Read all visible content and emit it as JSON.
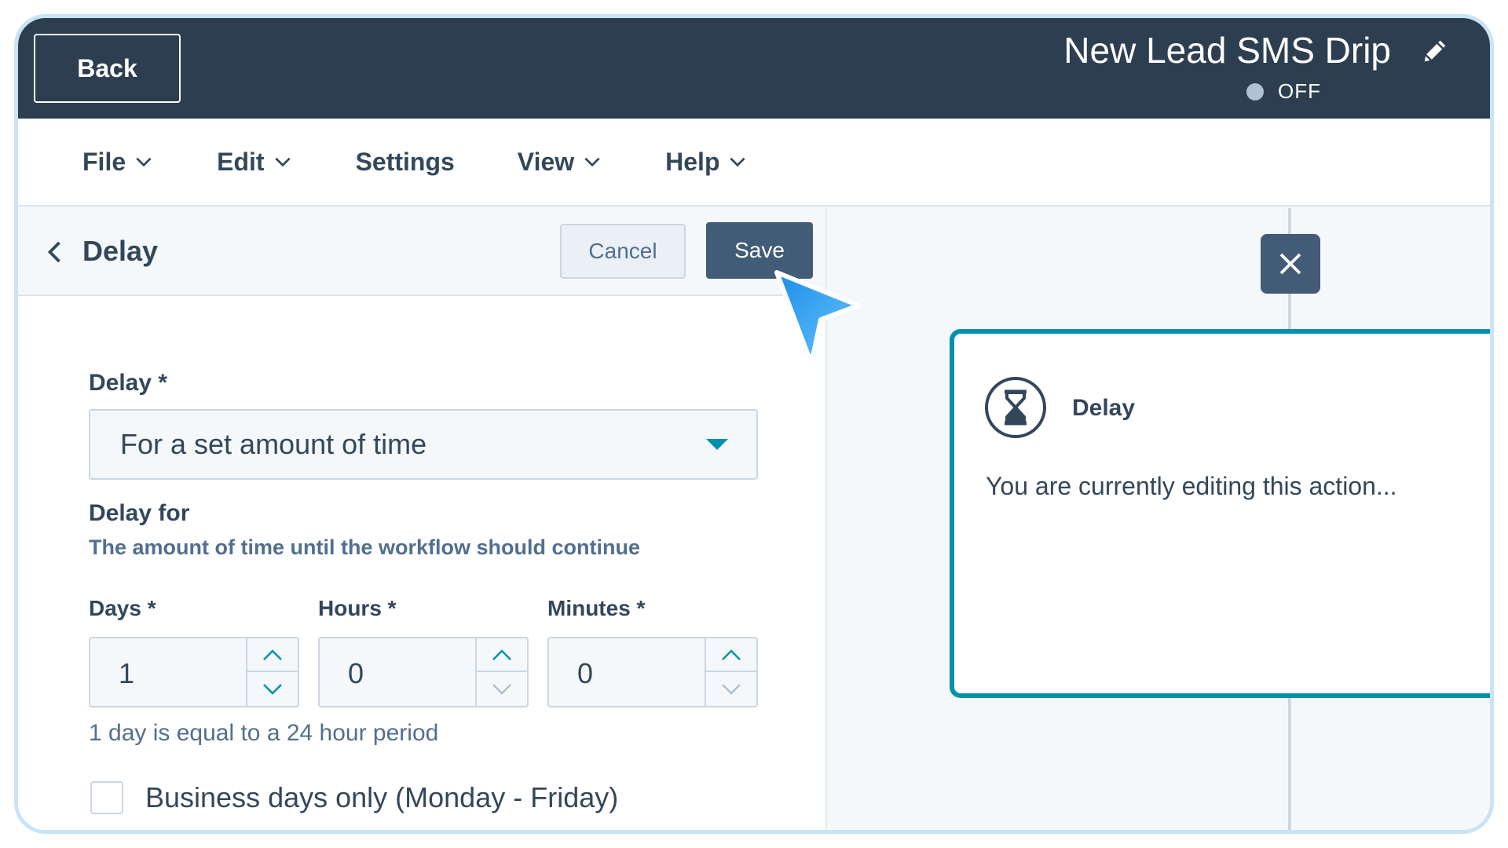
{
  "header": {
    "back_label": "Back",
    "workflow_title": "New Lead SMS Drip",
    "status_text": "OFF",
    "status_color": "#b0c1d4",
    "bg_color": "#2d3e50"
  },
  "menu": {
    "items": [
      {
        "label": "File",
        "has_dropdown": true
      },
      {
        "label": "Edit",
        "has_dropdown": true
      },
      {
        "label": "Settings",
        "has_dropdown": false
      },
      {
        "label": "View",
        "has_dropdown": true
      },
      {
        "label": "Help",
        "has_dropdown": true
      }
    ]
  },
  "panel": {
    "title": "Delay",
    "cancel_label": "Cancel",
    "save_label": "Save",
    "delay_label": "Delay *",
    "delay_selected": "For a set amount of time",
    "delay_for_label": "Delay for",
    "delay_for_help": "The amount of time until the workflow should continue",
    "fields": [
      {
        "label": "Days *",
        "value": "1"
      },
      {
        "label": "Hours *",
        "value": "0"
      },
      {
        "label": "Minutes *",
        "value": "0"
      }
    ],
    "footnote": "1 day is equal to a 24 hour period",
    "business_days_label": "Business days only (Monday - Friday)",
    "business_days_checked": false
  },
  "canvas": {
    "card_title": "Delay",
    "card_body": "You are currently editing this action...",
    "accent_color": "#0091ae"
  },
  "icons": [
    "pencil-icon",
    "chevron-down-icon",
    "chevron-left-icon",
    "chevron-up-icon",
    "close-icon",
    "hourglass-icon",
    "cursor-arrow-icon"
  ]
}
